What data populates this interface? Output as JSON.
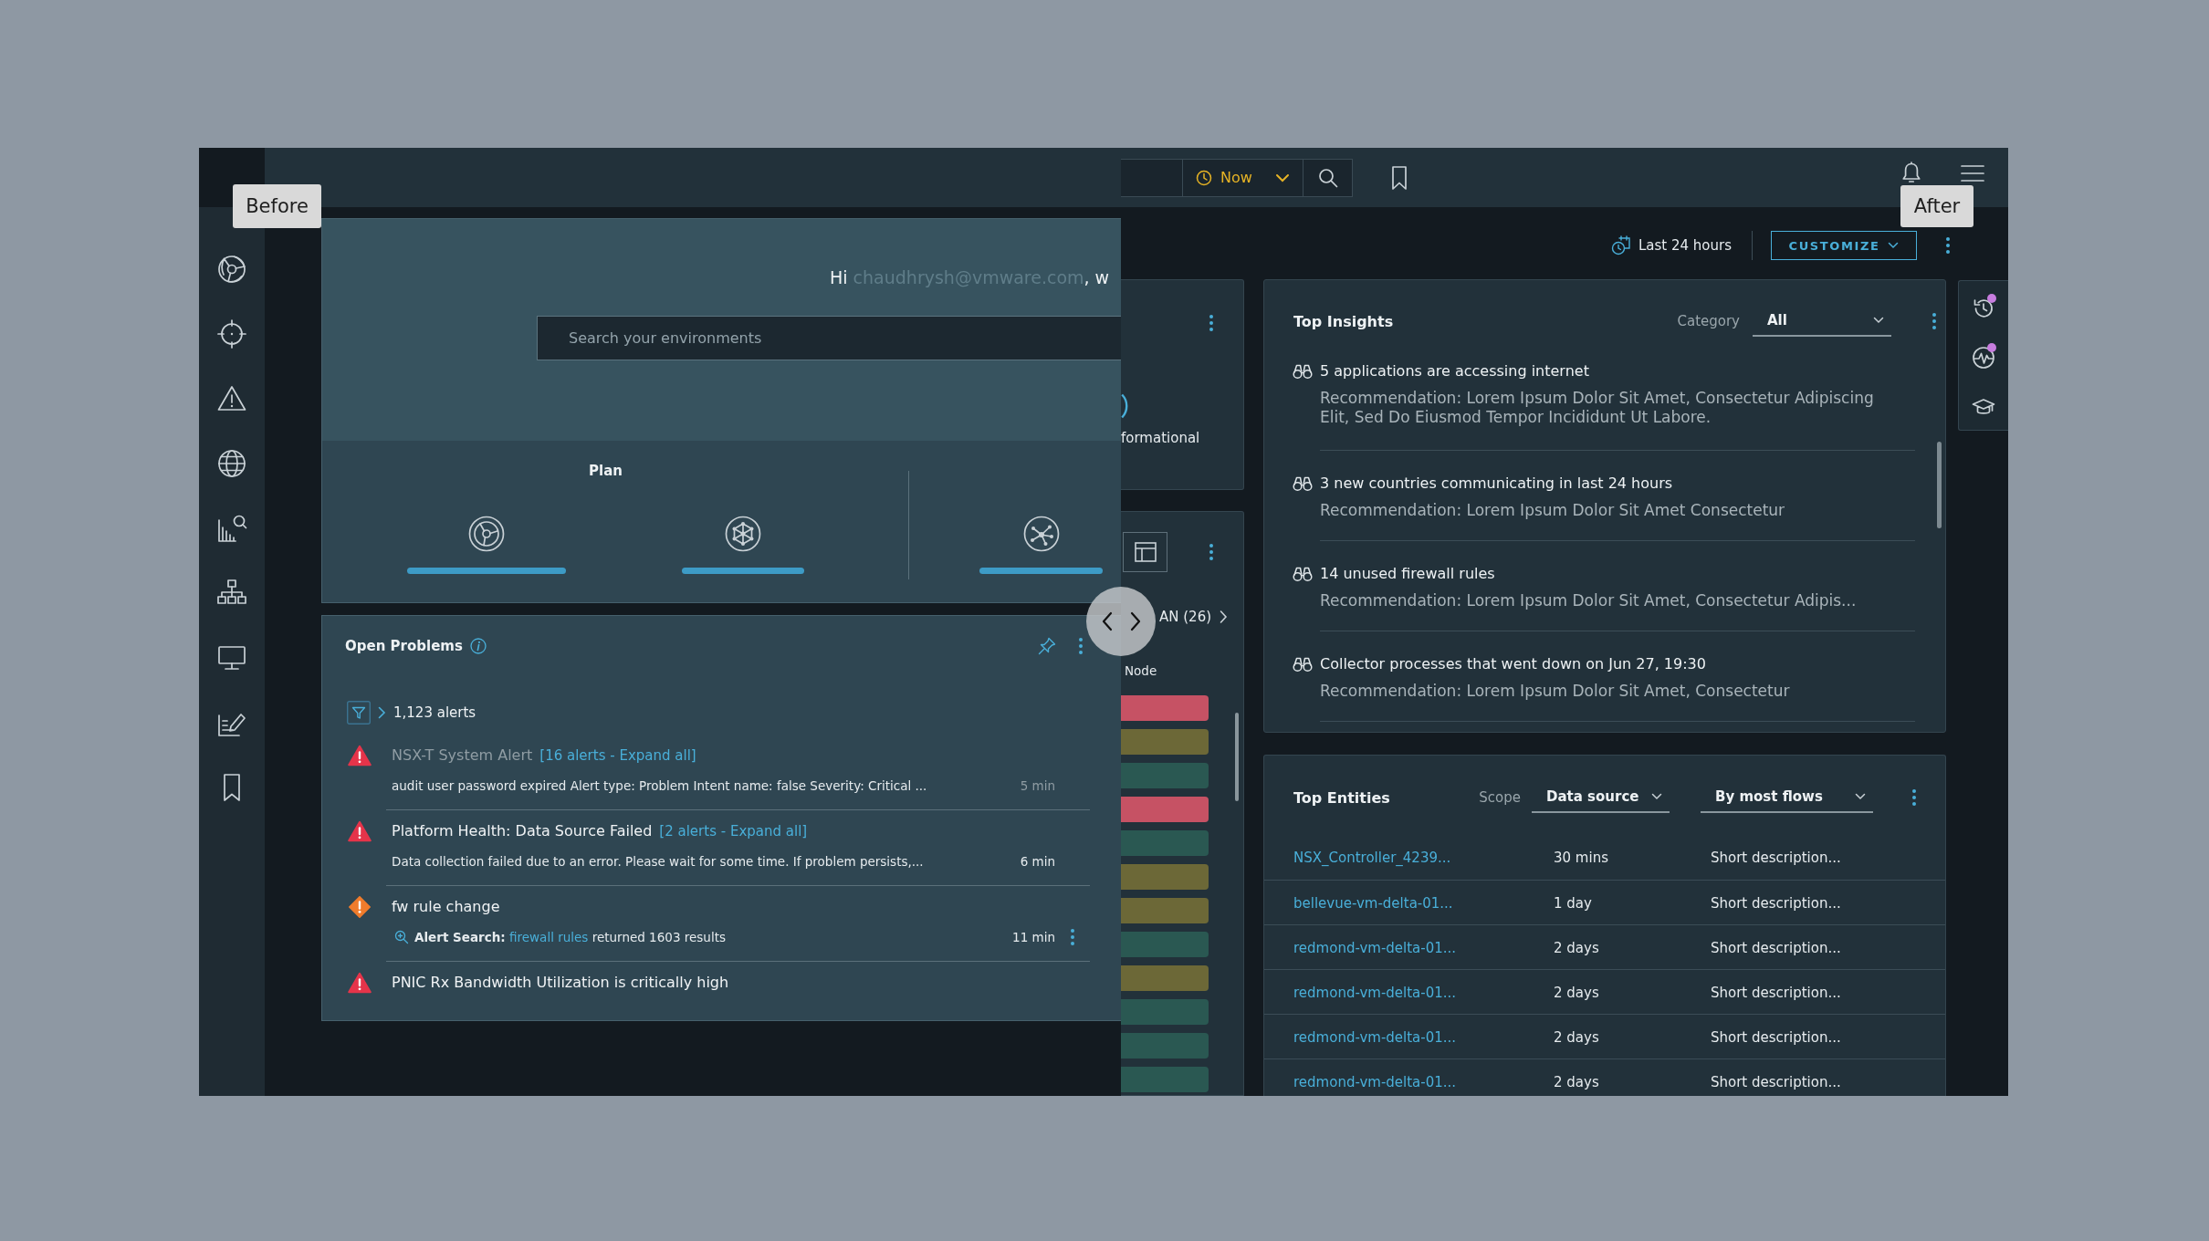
{
  "before": {
    "label": "Before",
    "greeting": {
      "hello": "Hi",
      "email": "chaudhrysh@vmware.com",
      "rest": ", w"
    },
    "search": {
      "placeholder": "Search your environments"
    },
    "plan": {
      "title": "Plan"
    },
    "open_problems": {
      "title": "Open Problems",
      "alert_count": "1,123 alerts",
      "alerts": [
        {
          "kind": "critical",
          "read": true,
          "title": "NSX-T System Alert",
          "expand_link": "[16 alerts - Expand all]",
          "description": "audit user password expired Alert type: Problem Intent name: false Severity: Critical ...",
          "time": "5 min",
          "menu": false
        },
        {
          "kind": "critical",
          "read": false,
          "title": "Platform Health: Data Source Failed",
          "expand_link": "[2 alerts - Expand all]",
          "description": "Data collection failed due to an error. Please wait for some time. If problem persists,...",
          "time": "6 min",
          "menu": false
        },
        {
          "kind": "warning",
          "read": false,
          "title": "fw rule change",
          "search": {
            "label": "Alert Search:",
            "link": "firewall rules",
            "result": "returned 1603 results"
          },
          "time": "11 min",
          "menu": true
        },
        {
          "kind": "critical",
          "read": false,
          "title": "PNIC Rx Bandwidth Utilization is critically high",
          "menu": false
        }
      ]
    }
  },
  "after": {
    "label": "After",
    "time_picker": {
      "value": "Now"
    },
    "time_range": "Last 24 hours",
    "customize_button": "CUSTOMIZE",
    "events_card": {
      "text": "formational"
    },
    "wan_card": {
      "title": "AN (26)",
      "column": "Node",
      "tiles": [
        {
          "color": "#c65264"
        },
        {
          "color": "#6c6837"
        },
        {
          "color": "#2a5852"
        },
        {
          "color": "#c65264"
        },
        {
          "color": "#2a5852"
        },
        {
          "color": "#6c6837"
        },
        {
          "color": "#6c6837"
        },
        {
          "color": "#2a5852"
        },
        {
          "color": "#6c6837"
        },
        {
          "color": "#2a5852"
        },
        {
          "color": "#2a5852"
        },
        {
          "color": "#2a5852"
        }
      ]
    },
    "top_insights": {
      "title": "Top Insights",
      "category_label": "Category",
      "category_value": "All",
      "items": [
        {
          "title": "5 applications are accessing internet",
          "recommendation": "Recommendation: Lorem Ipsum Dolor Sit Amet, Consectetur Adipiscing Elit, Sed Do Eiusmod Tempor Incididunt Ut Labore."
        },
        {
          "title": "3 new countries communicating in last 24 hours",
          "recommendation": "Recommendation: Lorem Ipsum Dolor Sit Amet Consectetur"
        },
        {
          "title": "14 unused firewall rules",
          "recommendation": "Recommendation: Lorem Ipsum Dolor Sit Amet, Consectetur Adipis..."
        },
        {
          "title": "Collector processes that went down on Jun 27, 19:30",
          "recommendation": "Recommendation: Lorem Ipsum Dolor Sit Amet, Consectetur"
        }
      ]
    },
    "side_tools": [
      {
        "kind": "history",
        "badge": true
      },
      {
        "kind": "activity",
        "badge": true
      },
      {
        "kind": "learning",
        "badge": false
      }
    ],
    "top_entities": {
      "title": "Top Entities",
      "scope_label": "Scope",
      "scope_value": "Data source",
      "sort_value": "By most flows",
      "rows": [
        {
          "name": "NSX_Controller_4239...",
          "age": "30 mins",
          "description": "Short description..."
        },
        {
          "name": "bellevue-vm-delta-01...",
          "age": "1 day",
          "description": "Short description..."
        },
        {
          "name": "redmond-vm-delta-01...",
          "age": "2 days",
          "description": "Short description..."
        },
        {
          "name": "redmond-vm-delta-01...",
          "age": "2 days",
          "description": "Short description..."
        },
        {
          "name": "redmond-vm-delta-01...",
          "age": "2 days",
          "description": "Short description..."
        },
        {
          "name": "redmond-vm-delta-01...",
          "age": "2 days",
          "description": "Short description..."
        }
      ]
    }
  }
}
